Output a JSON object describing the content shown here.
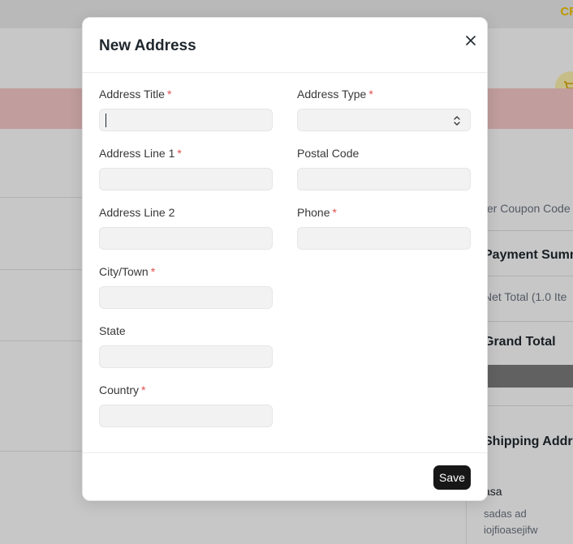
{
  "background": {
    "promo_text": "CR",
    "coupon_placeholder": "ter Coupon Code",
    "payment_summary": "Payment Summ",
    "net_total": "Net Total (1.0 Ite",
    "grand_total": "Grand Total",
    "shipping_address": "Shipping Addre",
    "address_name": "asa",
    "address_line1": "sadas ad",
    "address_line2": "iojfioasejifw"
  },
  "modal": {
    "title": "New Address",
    "close_icon": "close-icon",
    "required_marker": "*",
    "fields": {
      "address_title": {
        "label": "Address Title",
        "value": "",
        "required": true
      },
      "address_type": {
        "label": "Address Type",
        "value": "",
        "required": true
      },
      "address_line1": {
        "label": "Address Line 1",
        "value": "",
        "required": true
      },
      "postal_code": {
        "label": "Postal Code",
        "value": "",
        "required": false
      },
      "address_line2": {
        "label": "Address Line 2",
        "value": "",
        "required": false
      },
      "phone": {
        "label": "Phone",
        "value": "",
        "required": true
      },
      "city": {
        "label": "City/Town",
        "value": "",
        "required": true
      },
      "state": {
        "label": "State",
        "value": "",
        "required": false
      },
      "country": {
        "label": "Country",
        "value": "",
        "required": true
      }
    },
    "save_label": "Save"
  },
  "colors": {
    "required": "#e24c4c",
    "primary_button": "#171717",
    "input_bg": "#f2f2f2",
    "alert_bg": "#f8c9c9",
    "promo": "#f5c400"
  }
}
